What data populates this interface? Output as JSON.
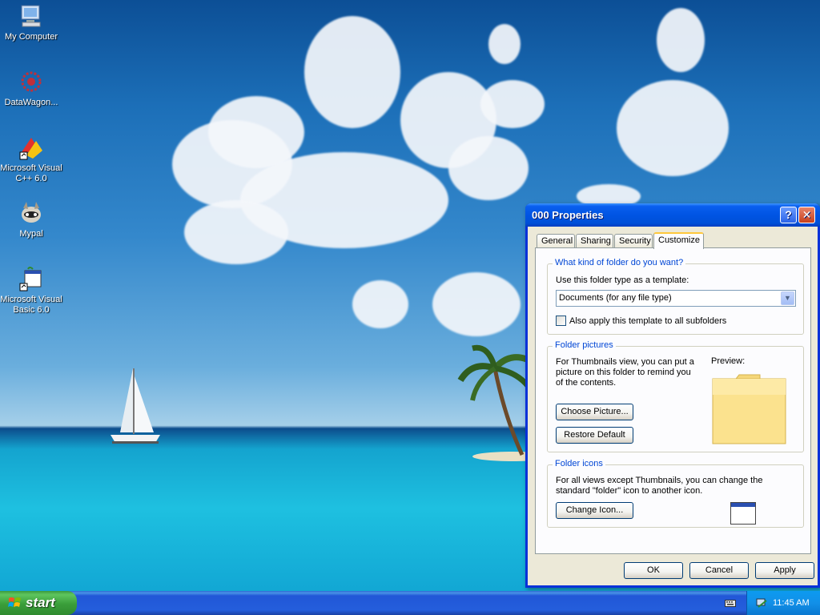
{
  "desktop": {
    "icons": [
      {
        "label": "My Computer",
        "icon": "my-computer-icon"
      },
      {
        "label": "DataWagon...",
        "icon": "datawagon-icon"
      },
      {
        "label": "Microsoft Visual C++ 6.0",
        "icon": "visual-cpp-icon"
      },
      {
        "label": "Mypal",
        "icon": "mypal-icon"
      },
      {
        "label": "Microsoft Visual Basic 6.0",
        "icon": "visual-basic-icon"
      }
    ]
  },
  "dialog": {
    "title": "000 Properties",
    "title_buttons": {
      "help": "?",
      "close": "✕"
    },
    "tabs": [
      "General",
      "Sharing",
      "Security",
      "Customize"
    ],
    "active_tab": "Customize",
    "folder_type": {
      "group_title": "What kind of folder do you want?",
      "template_label": "Use this folder type as a template:",
      "template_value": "Documents (for any file type)",
      "apply_subfolders_label": "Also apply this template to all subfolders",
      "apply_subfolders_checked": false
    },
    "folder_pictures": {
      "group_title": "Folder pictures",
      "description": "For Thumbnails view, you can put a picture on this folder to remind you of the contents.",
      "preview_label": "Preview:",
      "choose_button": "Choose Picture...",
      "restore_button": "Restore Default"
    },
    "folder_icons": {
      "group_title": "Folder icons",
      "description": "For all views except Thumbnails, you can change the standard \"folder\" icon to another icon.",
      "change_button": "Change Icon..."
    },
    "buttons": {
      "ok": "OK",
      "cancel": "Cancel",
      "apply": "Apply"
    }
  },
  "taskbar": {
    "start_label": "start",
    "clock": "11:45 AM"
  },
  "colors": {
    "titlebar": "#0054e3",
    "group_title": "#0046d5",
    "taskbar": "#245edc",
    "start": "#3a9e3a"
  }
}
